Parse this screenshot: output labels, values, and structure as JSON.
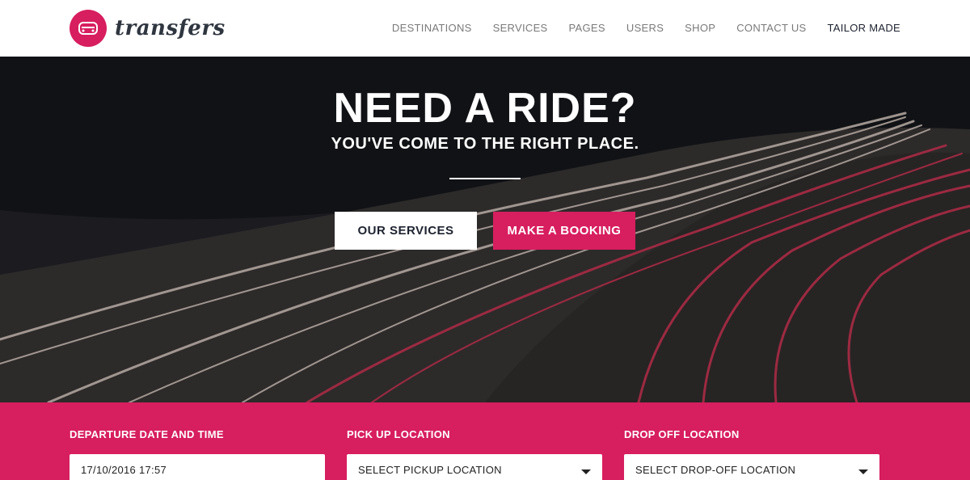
{
  "header": {
    "logo_text": "transfers",
    "nav": [
      {
        "label": "DESTINATIONS"
      },
      {
        "label": "SERVICES"
      },
      {
        "label": "PAGES"
      },
      {
        "label": "USERS"
      },
      {
        "label": "SHOP"
      },
      {
        "label": "CONTACT US"
      },
      {
        "label": "TAILOR MADE"
      }
    ]
  },
  "hero": {
    "title": "NEED A RIDE?",
    "subtitle": "YOU'VE COME TO THE RIGHT PLACE.",
    "services_button": "OUR SERVICES",
    "booking_button": "MAKE A BOOKING"
  },
  "booking": {
    "departure": {
      "label": "DEPARTURE DATE AND TIME",
      "value": "17/10/2016 17:57"
    },
    "pickup": {
      "label": "PICK UP LOCATION",
      "value": "SELECT PICKUP LOCATION"
    },
    "dropoff": {
      "label": "DROP OFF LOCATION",
      "value": "SELECT DROP-OFF LOCATION"
    }
  },
  "colors": {
    "accent": "#d71e5f",
    "dark_text": "#1e2330",
    "nav_text": "#7a7a7a"
  }
}
